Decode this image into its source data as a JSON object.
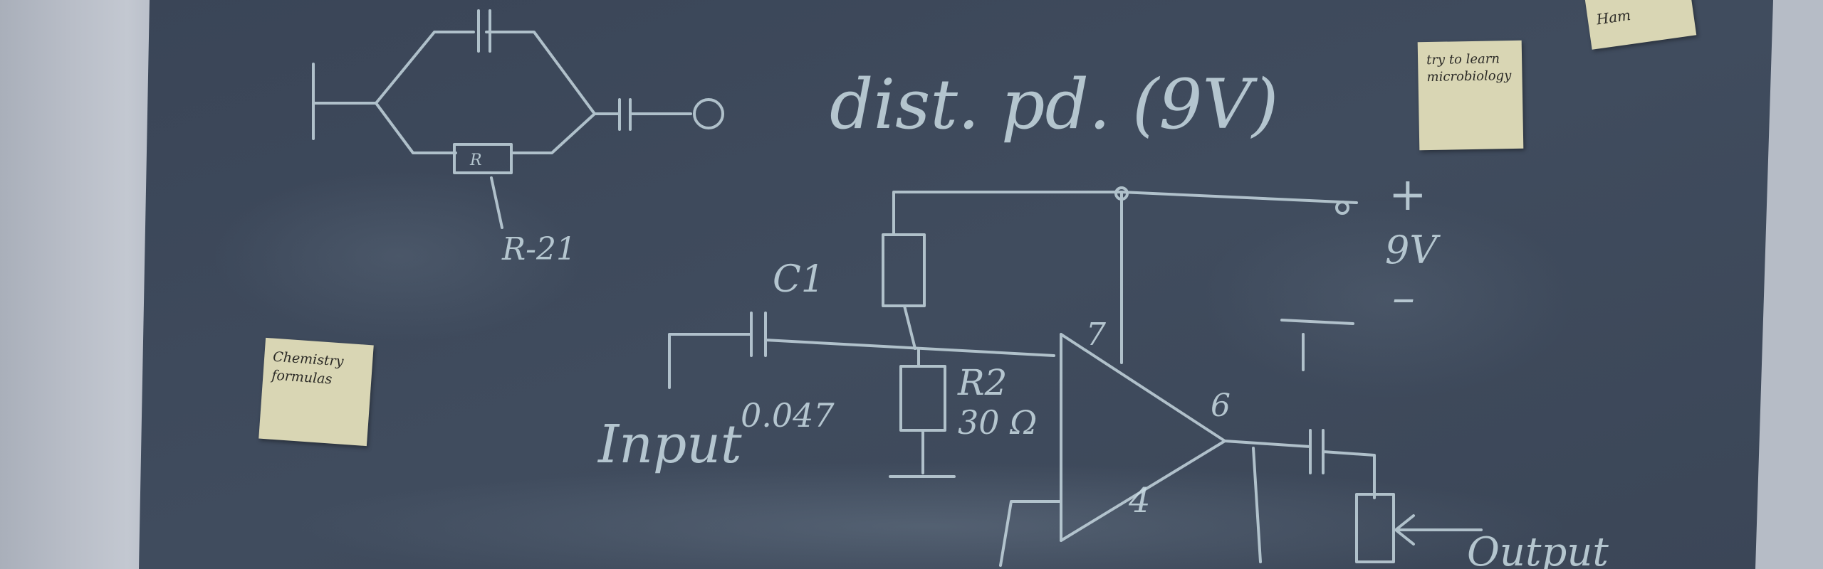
{
  "board_texts": {
    "formula": "dist. pd. (9V)",
    "r21": "R-21",
    "r_box": "R",
    "c1": "C1",
    "c1_value": "0.047",
    "input": "Input",
    "r2": "R2",
    "r2_value": "30 Ω",
    "pin7": "7",
    "pin6": "6",
    "pin4": "4",
    "plus": "+",
    "nine_v": "9V",
    "minus": "–",
    "output": "Output"
  },
  "notes": {
    "chemistry": [
      "Chemistry",
      "formulas"
    ],
    "microbiology": [
      "try to learn",
      "microbiology"
    ],
    "corner": "Ham"
  }
}
